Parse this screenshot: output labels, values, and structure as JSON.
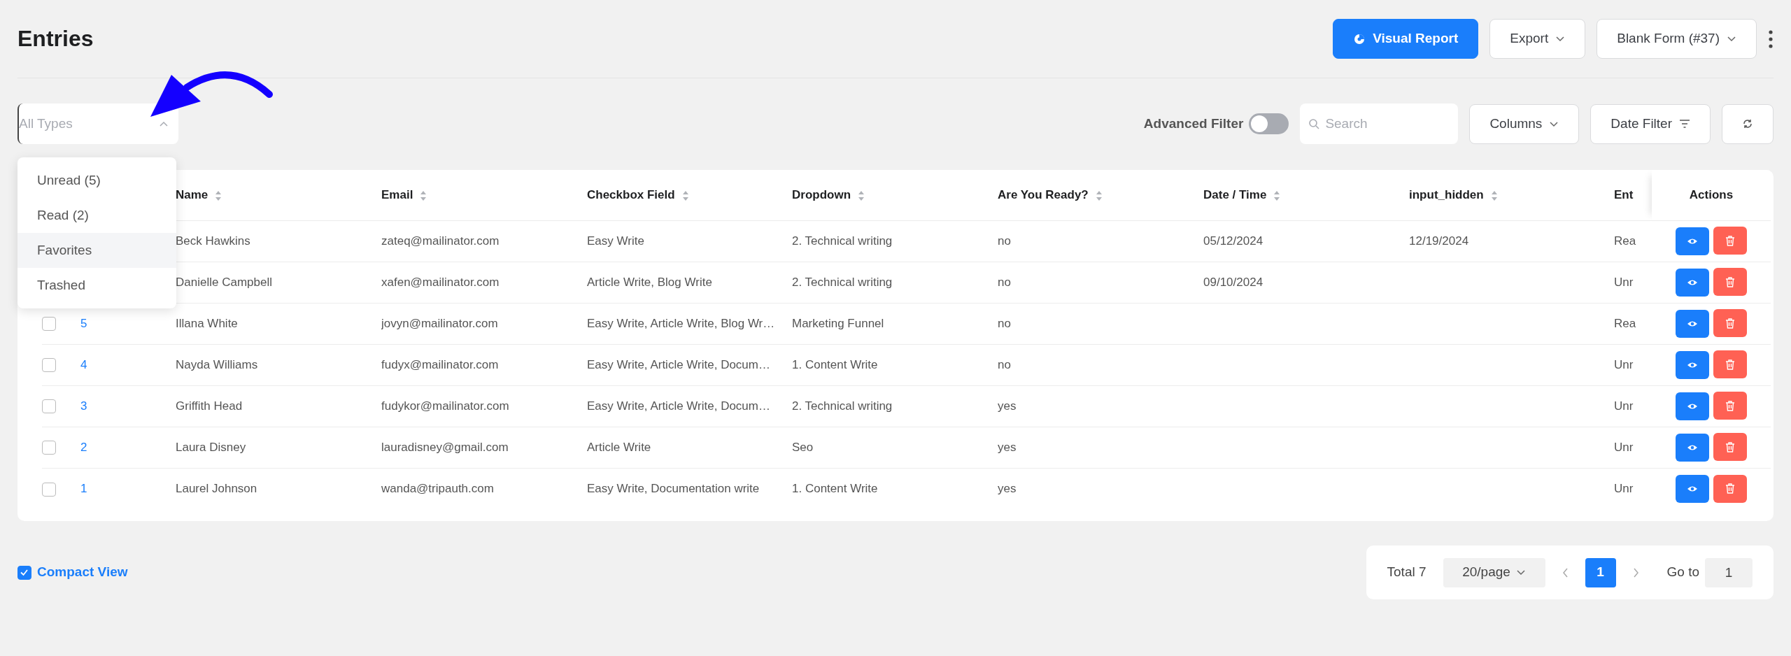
{
  "page": {
    "title": "Entries"
  },
  "header_actions": {
    "visual_report": "Visual Report",
    "export": "Export",
    "form_select": "Blank Form (#37)"
  },
  "type_filter": {
    "placeholder": "All Types",
    "expanded": true,
    "options": [
      {
        "label": "Unread (5)",
        "selected": false
      },
      {
        "label": "Read (2)",
        "selected": false
      },
      {
        "label": "Favorites",
        "selected": true
      },
      {
        "label": "Trashed",
        "selected": false
      }
    ]
  },
  "advanced_filter": {
    "label": "Advanced Filter",
    "on": false
  },
  "search": {
    "placeholder": "Search"
  },
  "columns_button": "Columns",
  "date_filter_button": "Date Filter",
  "table": {
    "columns": [
      "Name",
      "Email",
      "Checkbox Field",
      "Dropdown",
      "Are You Ready?",
      "Date / Time",
      "input_hidden",
      "Ent"
    ],
    "actions_header": "Actions",
    "rows": [
      {
        "cells": [
          "Beck Hawkins",
          "zateq@mailinator.com",
          "Easy Write",
          "2. Technical writing",
          "no",
          "05/12/2024",
          "12/19/2024",
          "Rea"
        ]
      },
      {
        "cells": [
          "Danielle Campbell",
          "xafen@mailinator.com",
          "Article Write, Blog Write",
          "2. Technical writing",
          "no",
          "09/10/2024",
          "",
          "Unr"
        ]
      },
      {
        "id": "5",
        "checked": false,
        "cells": [
          "Illana White",
          "jovyn@mailinator.com",
          "Easy Write, Article Write, Blog Wr…",
          "Marketing Funnel",
          "no",
          "",
          "",
          "Rea"
        ]
      },
      {
        "id": "4",
        "checked": false,
        "cells": [
          "Nayda Williams",
          "fudyx@mailinator.com",
          "Easy Write, Article Write, Docum…",
          "1. Content Write",
          "no",
          "",
          "",
          "Unr"
        ]
      },
      {
        "id": "3",
        "checked": false,
        "cells": [
          "Griffith Head",
          "fudykor@mailinator.com",
          "Easy Write, Article Write, Docum…",
          "2. Technical writing",
          "yes",
          "",
          "",
          "Unr"
        ]
      },
      {
        "id": "2",
        "checked": false,
        "cells": [
          "Laura Disney",
          "lauradisney@gmail.com",
          "Article Write",
          "Seo",
          "yes",
          "",
          "",
          "Unr"
        ]
      },
      {
        "id": "1",
        "checked": false,
        "cells": [
          "Laurel Johnson",
          "wanda@tripauth.com",
          "Easy Write, Documentation write",
          "1. Content Write",
          "yes",
          "",
          "",
          "Unr"
        ]
      }
    ]
  },
  "compact_view": {
    "label": "Compact View",
    "checked": true
  },
  "pagination": {
    "total": "Total 7",
    "page_size": "20/page",
    "pages": [
      {
        "label": "1",
        "selected": true
      }
    ],
    "goto_label": "Go to",
    "goto_value": "1"
  }
}
